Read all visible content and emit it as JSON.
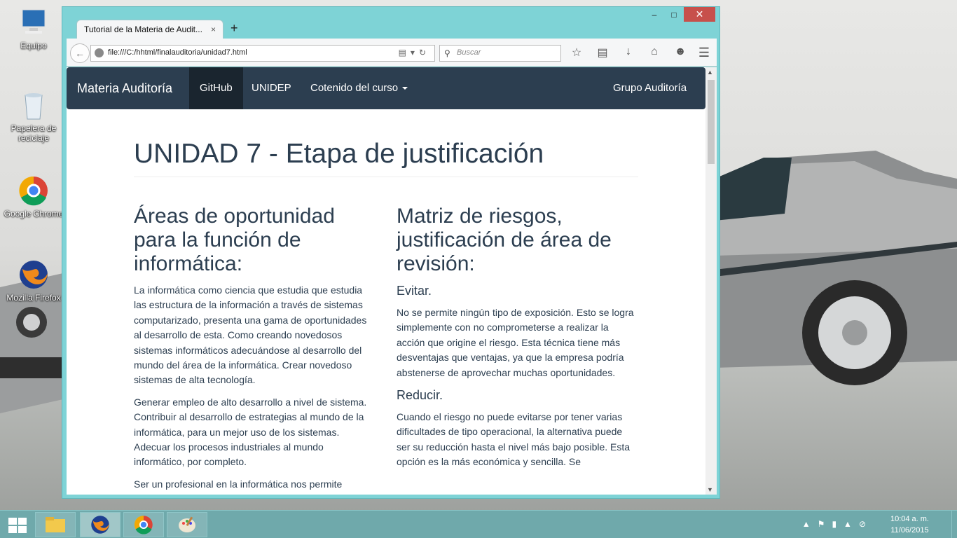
{
  "desktop": {
    "icons": [
      {
        "label": "Equipo"
      },
      {
        "label": "Papelera de reciclaje"
      },
      {
        "label": "Google Chrome"
      },
      {
        "label": "Mozilla Firefox"
      }
    ]
  },
  "browser": {
    "tab_title": "Tutorial de la Materia de Audit...",
    "tab_close": "×",
    "new_tab": "+",
    "url": "file:///C:/hhtml/finalauditoria/unidad7.html",
    "search_placeholder": "Buscar",
    "window_controls": {
      "minimize": "–",
      "maximize": "□",
      "close": "✕"
    }
  },
  "site_nav": {
    "brand": "Materia Auditoría",
    "links": [
      "GitHub",
      "UNIDEP",
      "Cotenido del curso"
    ],
    "right_link": "Grupo Auditoría"
  },
  "page": {
    "title": "UNIDAD 7 - Etapa de justificación",
    "left": {
      "heading": "Áreas de oportunidad para la función de informática:",
      "paragraphs": [
        "La informática  como ciencia que estudia  que estudia las estructura de la información a través de sistemas computarizado, presenta una gama de oportunidades al desarrollo de esta. Como creando novedosos sistemas informáticos adecuándose al desarrollo del mundo del área de la informática. Crear novedoso sistemas de alta tecnología.",
        "Generar empleo de alto desarrollo a nivel de sistema. Contribuir al desarrollo de estrategias al mundo de la informática, para un mejor uso de los sistemas. Adecuar los procesos industriales al mundo informático, por completo.",
        "Ser un profesional en la informática nos permite"
      ]
    },
    "right": {
      "heading": "Matriz de riesgos, justificación de área de revisión:",
      "sub1": "Evitar.",
      "p1": "No se permite ningún tipo de exposición. Esto se logra simplemente con no comprometerse a realizar la acción que origine el riesgo. Esta técnica tiene más desventajas que ventajas, ya que la empresa podría abstenerse de aprovechar muchas oportunidades.",
      "sub2": "Reducir.",
      "p2": "Cuando el riesgo no puede evitarse por tener varias dificultades de tipo operacional, la alternativa puede ser su reducción hasta el nivel más bajo posible. Esta opción es la más económica y sencilla. Se"
    }
  },
  "taskbar": {
    "time": "10:04 a. m.",
    "date": "11/06/2015"
  }
}
